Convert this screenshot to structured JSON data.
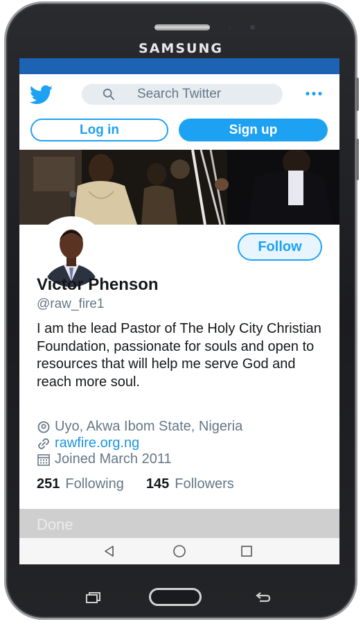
{
  "device": {
    "brand": "SAMSUNG"
  },
  "topbar": {
    "logo_icon": "twitter-bird-icon",
    "search_placeholder": "Search Twitter",
    "more_icon": "more-horizontal-icon"
  },
  "auth": {
    "login_label": "Log in",
    "signup_label": "Sign up"
  },
  "profile": {
    "name": "Victor Phenson",
    "handle": "@raw_fire1",
    "bio": "I am the lead Pastor of The Holy City Christian Foundation, passionate for souls and open to resources that will help me serve God and reach more soul.",
    "location": "Uyo, Akwa Ibom State, Nigeria",
    "website": "rawfire.org.ng",
    "joined": "Joined March 2011",
    "following_count": "251",
    "following_label": "Following",
    "followers_count": "145",
    "followers_label": "Followers",
    "follow_label": "Follow"
  },
  "footer": {
    "done_label": "Done"
  },
  "colors": {
    "twitter_blue": "#1da1f2",
    "status_bar": "#1d63b3",
    "secondary_text": "#657786",
    "primary_text": "#14171a"
  }
}
